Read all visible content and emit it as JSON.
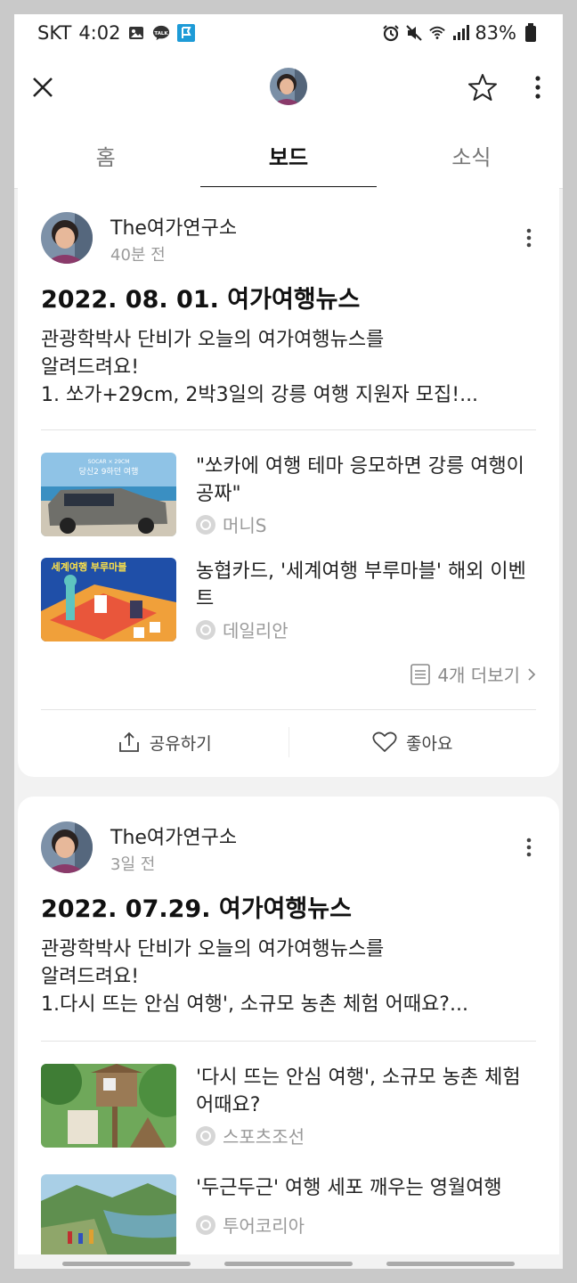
{
  "status_bar": {
    "carrier": "SKT",
    "time": "4:02",
    "battery": "83%",
    "icons_left": [
      "image-icon",
      "talk-icon",
      "flag-icon"
    ],
    "icons_right": [
      "alarm-icon",
      "mute-icon",
      "wifi-icon",
      "signal-icon",
      "battery-icon"
    ]
  },
  "header": {
    "close_icon": "close-icon",
    "star_icon": "star-icon",
    "more_icon": "more-vertical-icon"
  },
  "tabs": [
    {
      "label": "홈",
      "active": false
    },
    {
      "label": "보드",
      "active": true
    },
    {
      "label": "소식",
      "active": false
    }
  ],
  "posts": [
    {
      "author": "The여가연구소",
      "time": "40분 전",
      "title": "2022. 08. 01. 여가여행뉴스",
      "body": "관광학박사 단비가 오늘의 여가여행뉴스를\n알려드려요!\n1. 쏘가+29cm,  2박3일의 강릉 여행 지원자 모집!...",
      "news": [
        {
          "title": "\"쏘카에 여행 테마 응모하면 강릉 여행이 공짜\"",
          "source": "머니S",
          "thumb_text": "당신2 9하던 여행"
        },
        {
          "title": "농협카드, '세계여행 부루마블' 해외 이벤트",
          "source": "데일리안",
          "thumb_text": "세계여행 부루마블"
        }
      ],
      "more_label": "4개 더보기",
      "share_label": "공유하기",
      "like_label": "좋아요"
    },
    {
      "author": "The여가연구소",
      "time": "3일 전",
      "title": "2022. 07.29. 여가여행뉴스",
      "body": "관광학박사 단비가 오늘의 여가여행뉴스를\n알려드려요!\n1.다시 뜨는 안심 여행', 소규모 농촌 체험 어때요?...",
      "news": [
        {
          "title": "'다시 뜨는 안심 여행', 소규모 농촌 체험 어때요?",
          "source": "스포츠조선"
        },
        {
          "title": "'두근두근' 여행 세포 깨우는 영월여행",
          "source": "투어코리아"
        }
      ]
    }
  ]
}
